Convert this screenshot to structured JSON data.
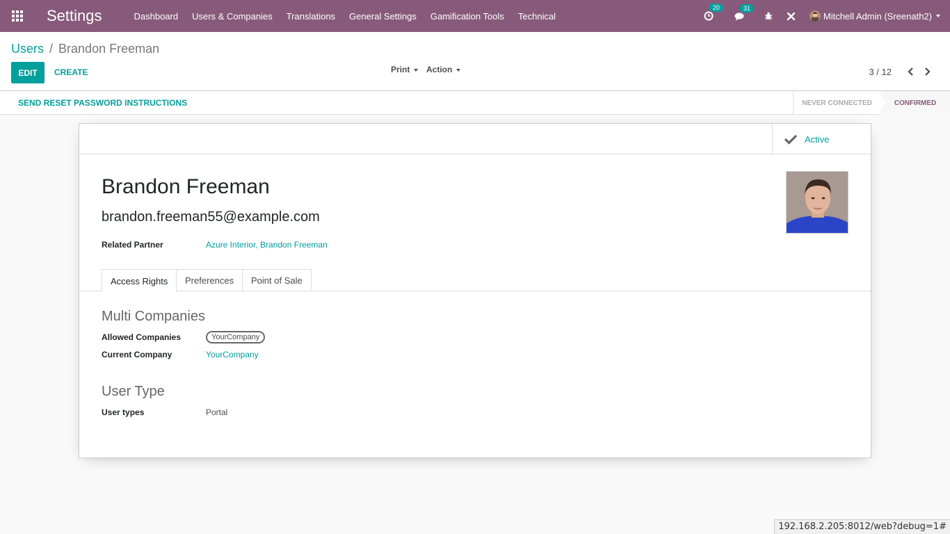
{
  "navbar": {
    "app_title": "Settings",
    "menu": [
      "Dashboard",
      "Users & Companies",
      "Translations",
      "General Settings",
      "Gamification Tools",
      "Technical"
    ],
    "activity_count": "20",
    "messages_count": "31",
    "user_name": "Mitchell Admin (Sreenath2)"
  },
  "control_panel": {
    "breadcrumb_parent": "Users",
    "breadcrumb_separator": "/",
    "breadcrumb_current": "Brandon Freeman",
    "edit_label": "EDIT",
    "create_label": "CREATE",
    "print_label": "Print",
    "action_label": "Action",
    "pager_value": "3 / 12"
  },
  "statusbar": {
    "reset_label": "SEND RESET PASSWORD INSTRUCTIONS",
    "stages": [
      "NEVER CONNECTED",
      "CONFIRMED"
    ],
    "current_stage": "CONFIRMED"
  },
  "form": {
    "active_label": "Active",
    "name": "Brandon Freeman",
    "login": "brandon.freeman55@example.com",
    "related_partner_label": "Related Partner",
    "related_partner_value": "Azure Interior, Brandon Freeman",
    "tabs": [
      "Access Rights",
      "Preferences",
      "Point of Sale"
    ],
    "multi_companies_title": "Multi Companies",
    "allowed_companies_label": "Allowed Companies",
    "allowed_companies_tag": "YourCompany",
    "current_company_label": "Current Company",
    "current_company_value": "YourCompany",
    "user_type_title": "User Type",
    "user_types_label": "User types",
    "user_types_value": "Portal"
  },
  "status_url": "192.168.2.205:8012/web?debug=1#",
  "colors": {
    "brand": "#875a7b",
    "accent": "#00a09d"
  }
}
